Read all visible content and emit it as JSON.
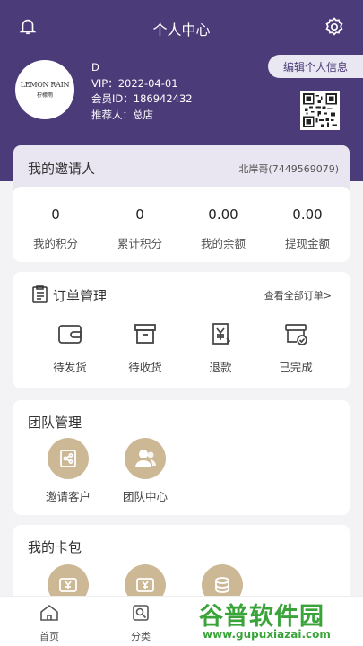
{
  "header": {
    "title": "个人中心",
    "bg_color": "#4b3b78",
    "icons": [
      "bell-icon",
      "gear-icon"
    ]
  },
  "profile": {
    "logo_line1": "LEMON RAIN",
    "logo_line2": "柠檬雨",
    "name": "D",
    "vip": "VIP：2022-04-01",
    "member_id": "会员ID：186942432",
    "referrer": "推荐人：总店",
    "edit_label": "编辑个人信息"
  },
  "invite": {
    "label": "我的邀请人",
    "inviter": "北岸哥(7449569079)"
  },
  "stats": [
    {
      "value": "0",
      "label": "我的积分"
    },
    {
      "value": "0",
      "label": "累计积分"
    },
    {
      "value": "0.00",
      "label": "我的余额"
    },
    {
      "value": "0.00",
      "label": "提现金额"
    }
  ],
  "orders": {
    "title": "订单管理",
    "view_all": "查看全部订单>",
    "items": [
      {
        "label": "待发货",
        "icon": "wallet-icon"
      },
      {
        "label": "待收货",
        "icon": "box-icon"
      },
      {
        "label": "退款",
        "icon": "refund-icon"
      },
      {
        "label": "已完成",
        "icon": "completed-icon"
      }
    ]
  },
  "team": {
    "title": "团队管理",
    "items": [
      {
        "label": "邀请客户",
        "icon": "share-icon"
      },
      {
        "label": "团队中心",
        "icon": "people-icon"
      }
    ],
    "accent": "#cdb896"
  },
  "card_pack": {
    "title": "我的卡包"
  },
  "tabbar": [
    {
      "label": "首页",
      "icon": "home-icon"
    },
    {
      "label": "分类",
      "icon": "category-icon"
    }
  ],
  "watermark": {
    "text": "谷普软件园",
    "url": "www.gupuxiazai.com"
  }
}
